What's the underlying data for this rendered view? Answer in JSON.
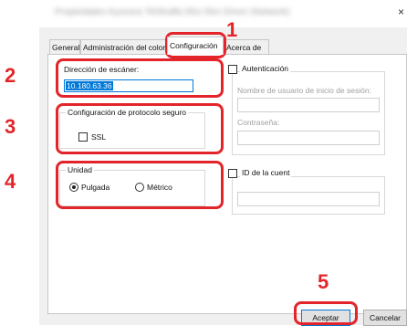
{
  "window": {
    "title": "Propiedades Kyocera TASKalfa 00ci 00ci Driver (Network)",
    "close_glyph": "×"
  },
  "tabs": [
    {
      "label": "General"
    },
    {
      "label": "Administración del color"
    },
    {
      "label": "Configuración"
    },
    {
      "label": "Acerca de"
    }
  ],
  "scanner": {
    "address_label": "Dirección de escáner:",
    "address_value": "10.180.63.36"
  },
  "secure": {
    "group_label": "Configuración de protocolo seguro",
    "ssl_label": "SSL"
  },
  "unit": {
    "group_label": "Unidad",
    "inch_label": "Pulgada",
    "metric_label": "Métrico",
    "selected": "Pulgada"
  },
  "auth": {
    "label": "Autenticación",
    "username_label": "Nombre de usuario de inicio de sesión:",
    "password_label": "Contraseña:"
  },
  "account": {
    "label": "ID de la cuent"
  },
  "buttons": {
    "ok": "Aceptar",
    "cancel": "Cancelar"
  },
  "callouts": [
    "1",
    "2",
    "3",
    "4",
    "5"
  ],
  "colors": {
    "callout_red": "#e3252b",
    "selection_blue": "#0078d7"
  }
}
